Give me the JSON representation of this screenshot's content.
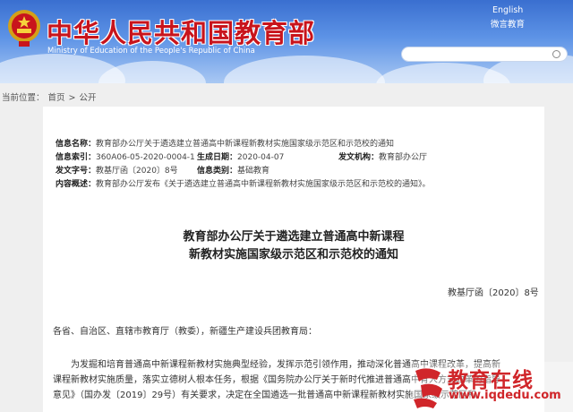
{
  "header": {
    "title": "中华人民共和国教育部",
    "subtitle": "Ministry of Education of the People's Republic of China",
    "lang_english": "English",
    "lang_weibo": "微言教育"
  },
  "breadcrumb": {
    "prefix": "当前位置：",
    "home": "首页",
    "sep": ">",
    "current": "公开"
  },
  "meta": {
    "title_label": "信息名称：",
    "title_value": "教育部办公厅关于遴选建立普通高中新课程新教材实施国家级示范区和示范校的通知",
    "index_label": "信息索引：",
    "index_value": "360A06-05-2020-0004-1",
    "date_label": "生成日期：",
    "date_value": "2020-04-07",
    "org_label": "发文机构：",
    "org_value": "教育部办公厅",
    "docno_label": "发文字号：",
    "docno_value": "教基厅函〔2020〕8号",
    "category_label": "信息类别：",
    "category_value": "基础教育",
    "summary_label": "内容概述：",
    "summary_value": "教育部办公厅发布《关于遴选建立普通高中新课程新教材实施国家级示范区和示范校的通知》。"
  },
  "doc": {
    "title_line1": "教育部办公厅关于遴选建立普通高中新课程",
    "title_line2": "新教材实施国家级示范区和示范校的通知",
    "number": "教基厅函〔2020〕8号",
    "salutation": "各省、自治区、直辖市教育厅（教委），新疆生产建设兵团教育局：",
    "p1": "为发掘和培育普通高中新课程新教材实施典型经验，发挥示范引领作用，推动深化普通高中课程改革，提高新",
    "p2": "课程新教材实施质量，落实立德树人根本任务，根据《国务院办公厅关于新时代推进普通高中育人方式改革的指导",
    "p3": "意见》（国办发〔2019〕29号）有关要求，决定在全国遴选一批普通高中新课程新教材实施国家级示范区和"
  },
  "watermark": {
    "text": "教育在线",
    "url": "www.iqdedu.com"
  },
  "colors": {
    "brand_red": "#c8141c",
    "header_blue": "#3a6fd0"
  }
}
